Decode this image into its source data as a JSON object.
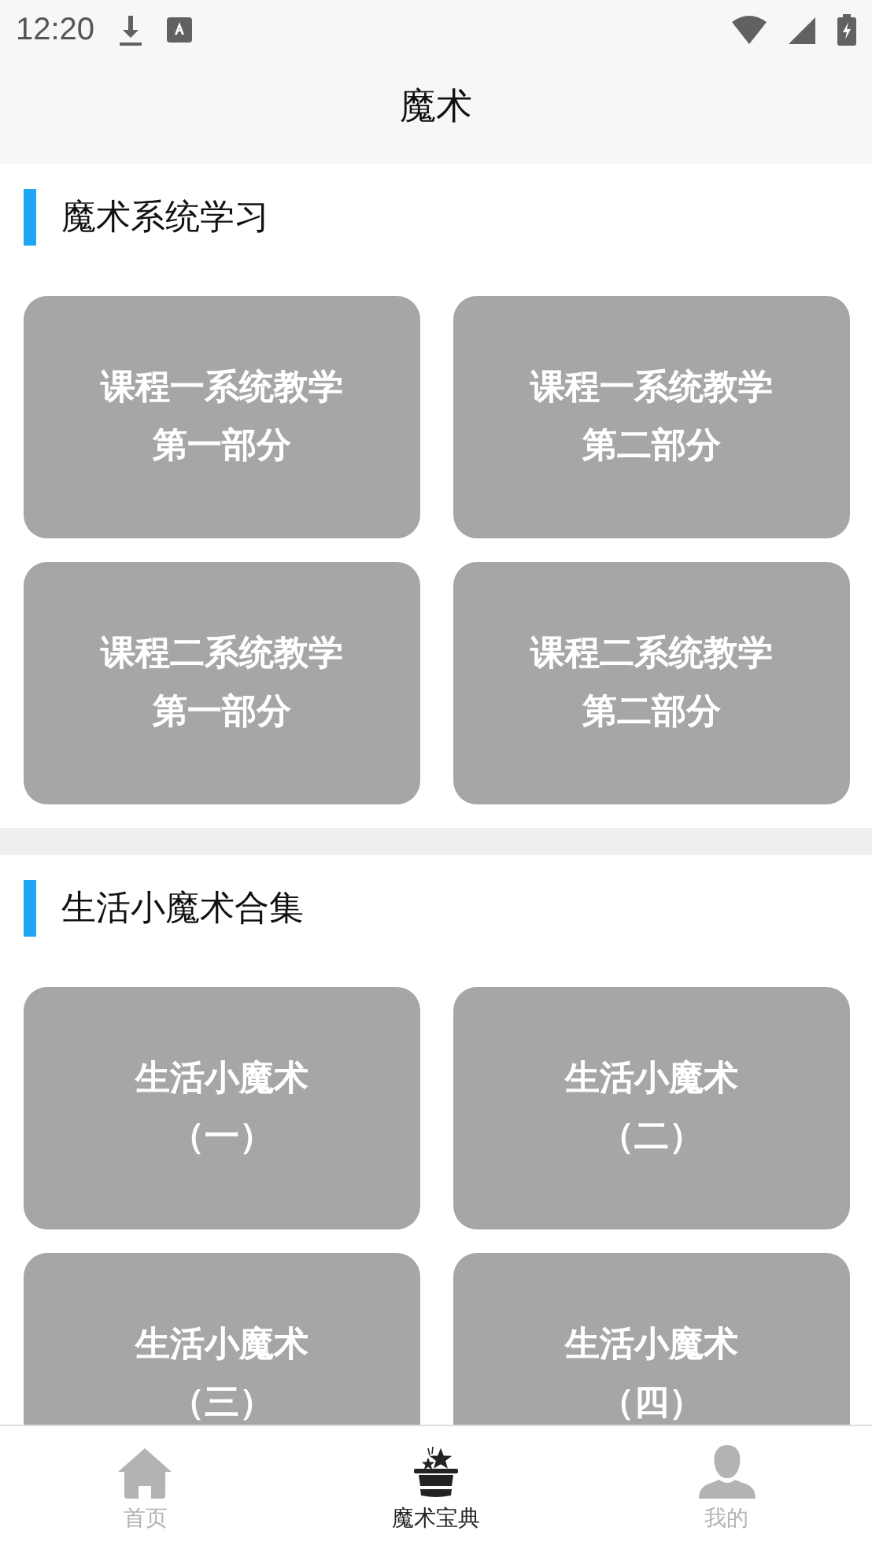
{
  "status_bar": {
    "time": "12:20"
  },
  "header": {
    "title": "魔术"
  },
  "sections": [
    {
      "title": "魔术系统学习",
      "cards": [
        {
          "lines": [
            "课程一系统教学",
            "第一部分"
          ]
        },
        {
          "lines": [
            "课程一系统教学",
            "第二部分"
          ]
        },
        {
          "lines": [
            "课程二系统教学",
            "第一部分"
          ]
        },
        {
          "lines": [
            "课程二系统教学",
            "第二部分"
          ]
        }
      ]
    },
    {
      "title": "生活小魔术合集",
      "cards": [
        {
          "lines": [
            "生活小魔术",
            "（一）"
          ]
        },
        {
          "lines": [
            "生活小魔术",
            "（二）"
          ]
        },
        {
          "lines": [
            "生活小魔术",
            "（三）"
          ]
        },
        {
          "lines": [
            "生活小魔术",
            "（四）"
          ]
        }
      ]
    }
  ],
  "tab_bar": [
    {
      "kind": "home",
      "label": "首页",
      "selected": false
    },
    {
      "kind": "magic",
      "label": "魔术宝典",
      "selected": true
    },
    {
      "kind": "person",
      "label": "我的",
      "selected": false
    }
  ]
}
